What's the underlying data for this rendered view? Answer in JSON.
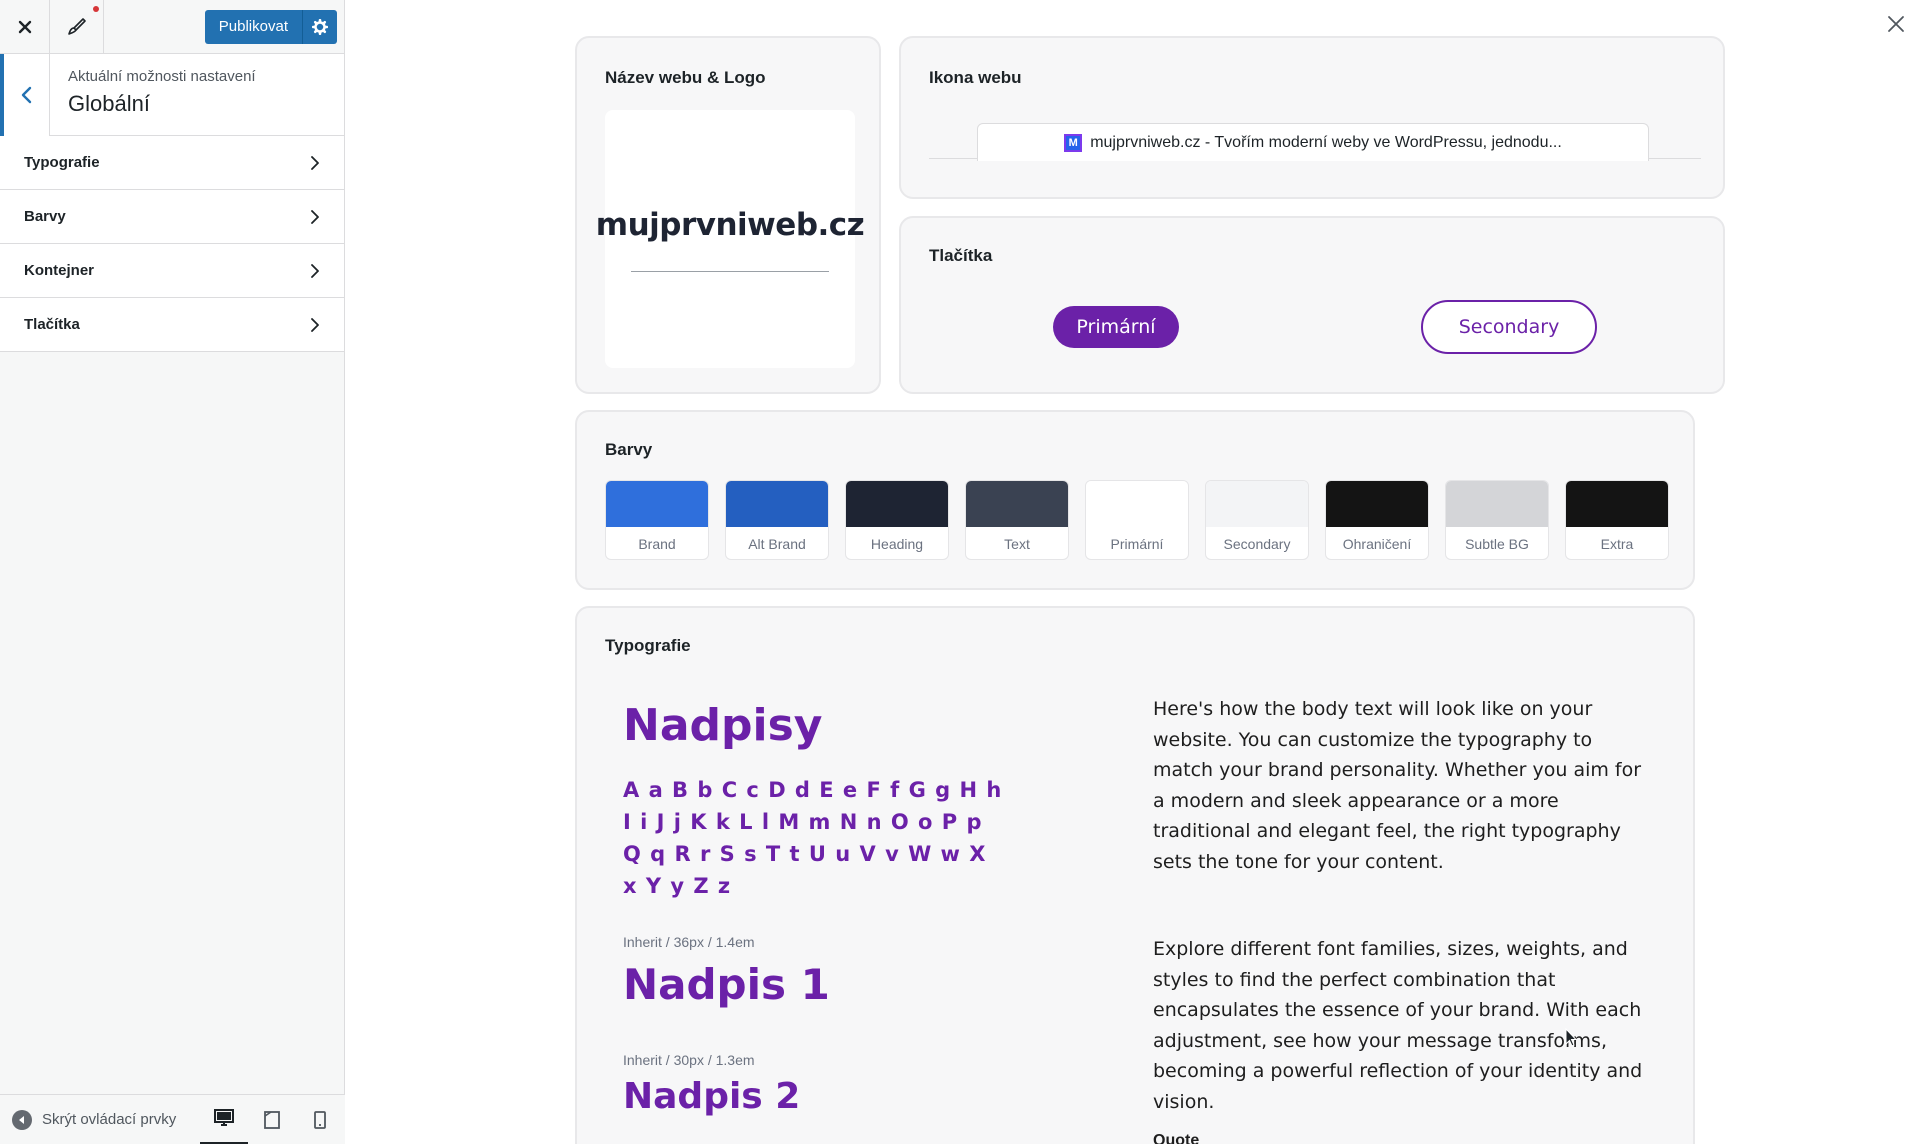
{
  "sidebar": {
    "publish_label": "Publikovat",
    "section_subtitle": "Aktuální možnosti nastavení",
    "section_title": "Globální",
    "items": [
      {
        "label": "Typografie"
      },
      {
        "label": "Barvy"
      },
      {
        "label": "Kontejner"
      },
      {
        "label": "Tlačítka"
      }
    ],
    "footer": {
      "collapse_label": "Skrýt ovládací prvky",
      "active_device": "desktop"
    }
  },
  "preview": {
    "site_card": {
      "title": "Název webu & Logo",
      "logo_text": "mujprvniweb.cz"
    },
    "icon_card": {
      "title": "Ikona webu",
      "favicon_letter": "M",
      "tab_text": "mujprvniweb.cz - Tvořím moderní weby ve WordPressu, jednodu..."
    },
    "buttons_card": {
      "title": "Tlačítka",
      "primary_label": "Primární",
      "secondary_label": "Secondary",
      "accent_color": "#6b21a8"
    },
    "colors_card": {
      "title": "Barvy",
      "swatches": [
        {
          "label": "Brand",
          "color": "#2f6fdc"
        },
        {
          "label": "Alt Brand",
          "color": "#245fc0"
        },
        {
          "label": "Heading",
          "color": "#1e2433"
        },
        {
          "label": "Text",
          "color": "#3a4252"
        },
        {
          "label": "Primární",
          "color": "#ffffff"
        },
        {
          "label": "Secondary",
          "color": "#f3f4f6"
        },
        {
          "label": "Ohraničení",
          "color": "#141414"
        },
        {
          "label": "Subtle BG",
          "color": "#d4d5d8"
        },
        {
          "label": "Extra",
          "color": "#141414"
        }
      ]
    },
    "typography_card": {
      "title": "Typografie",
      "headings_title": "Nadpisy",
      "alphabet": "A a B b C c D d E e F f G g H h I i J j K k L l M m N n O o P p Q q R r S s T t U u V v W w X x Y y Z z",
      "h1_meta": "Inherit / 36px / 1.4em",
      "h1_sample": "Nadpis 1",
      "h2_meta": "Inherit / 30px / 1.3em",
      "h2_sample": "Nadpis 2",
      "body_paragraph_1": "Here's how the body text will look like on your website. You can customize the typography to match your brand personality. Whether you aim for a modern and sleek appearance or a more traditional and elegant feel, the right typography sets the tone for your content.",
      "body_paragraph_2": "Explore different font families, sizes, weights, and styles to find the perfect combination that encapsulates the essence of your brand. With each adjustment, see how your message transforms, becoming a powerful reflection of your identity and vision.",
      "quote_label": "Quote"
    }
  }
}
